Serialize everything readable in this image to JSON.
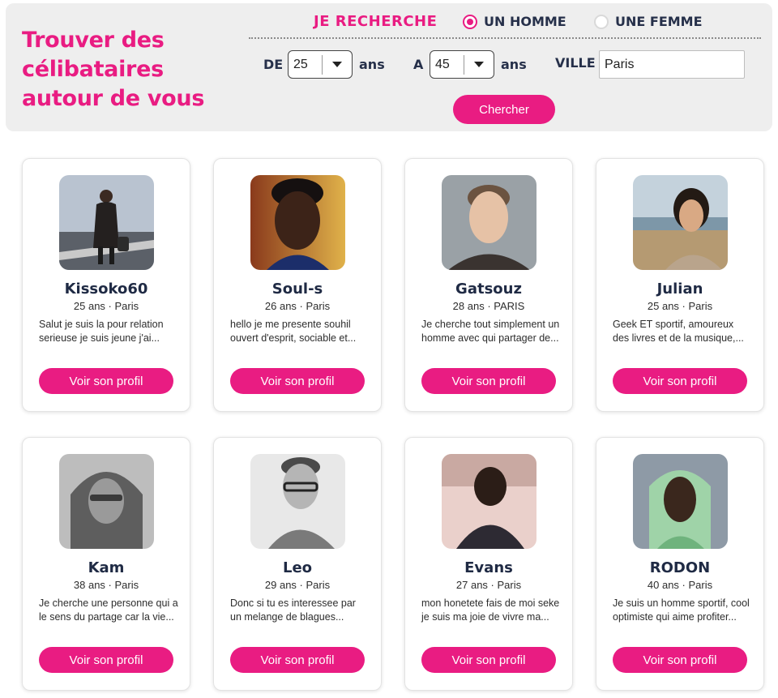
{
  "search": {
    "headline": "Trouver des célibataires autour de vous",
    "recherche_label": "JE RECHERCHE",
    "gender_options": [
      {
        "label": "UN HOMME",
        "checked": true
      },
      {
        "label": "UNE FEMME",
        "checked": false
      }
    ],
    "age_from_label": "DE",
    "age_from_value": "25",
    "age_to_label": "A",
    "age_to_value": "45",
    "ans_label": "ans",
    "ville_label": "VILLE",
    "ville_value": "Paris",
    "submit_label": "Chercher"
  },
  "colors": {
    "accent": "#e91c82",
    "panel": "#eeeeee",
    "text": "#1f2a44"
  },
  "profiles": [
    {
      "name": "Kissoko60",
      "meta": "25 ans · Paris",
      "desc": "Salut je suis la pour relation serieuse je suis jeune j'ai...",
      "button": "Voir son profil"
    },
    {
      "name": "Soul-s",
      "meta": "26 ans · Paris",
      "desc": "hello je me presente souhil ouvert d'esprit, sociable et...",
      "button": "Voir son profil"
    },
    {
      "name": "Gatsouz",
      "meta": "28 ans · PARIS",
      "desc": "Je cherche tout simplement un homme avec qui partager de...",
      "button": "Voir son profil"
    },
    {
      "name": "Julian",
      "meta": "25 ans · Paris",
      "desc": "Geek ET sportif, amoureux des livres et de la musique,...",
      "button": "Voir son profil"
    },
    {
      "name": "Kam",
      "meta": "38 ans · Paris",
      "desc": "Je cherche une personne qui a le sens du partage car la vie...",
      "button": "Voir son profil"
    },
    {
      "name": "Leo",
      "meta": "29 ans · Paris",
      "desc": "Donc si tu es interessee par un melange de blagues...",
      "button": "Voir son profil"
    },
    {
      "name": "Evans",
      "meta": "27 ans · Paris",
      "desc": "mon honetete fais de moi seke je suis ma joie de vivre ma...",
      "button": "Voir son profil"
    },
    {
      "name": "RODON",
      "meta": "40 ans · Paris",
      "desc": "Je suis un homme sportif, cool optimiste qui aime profiter...",
      "button": "Voir son profil"
    }
  ]
}
